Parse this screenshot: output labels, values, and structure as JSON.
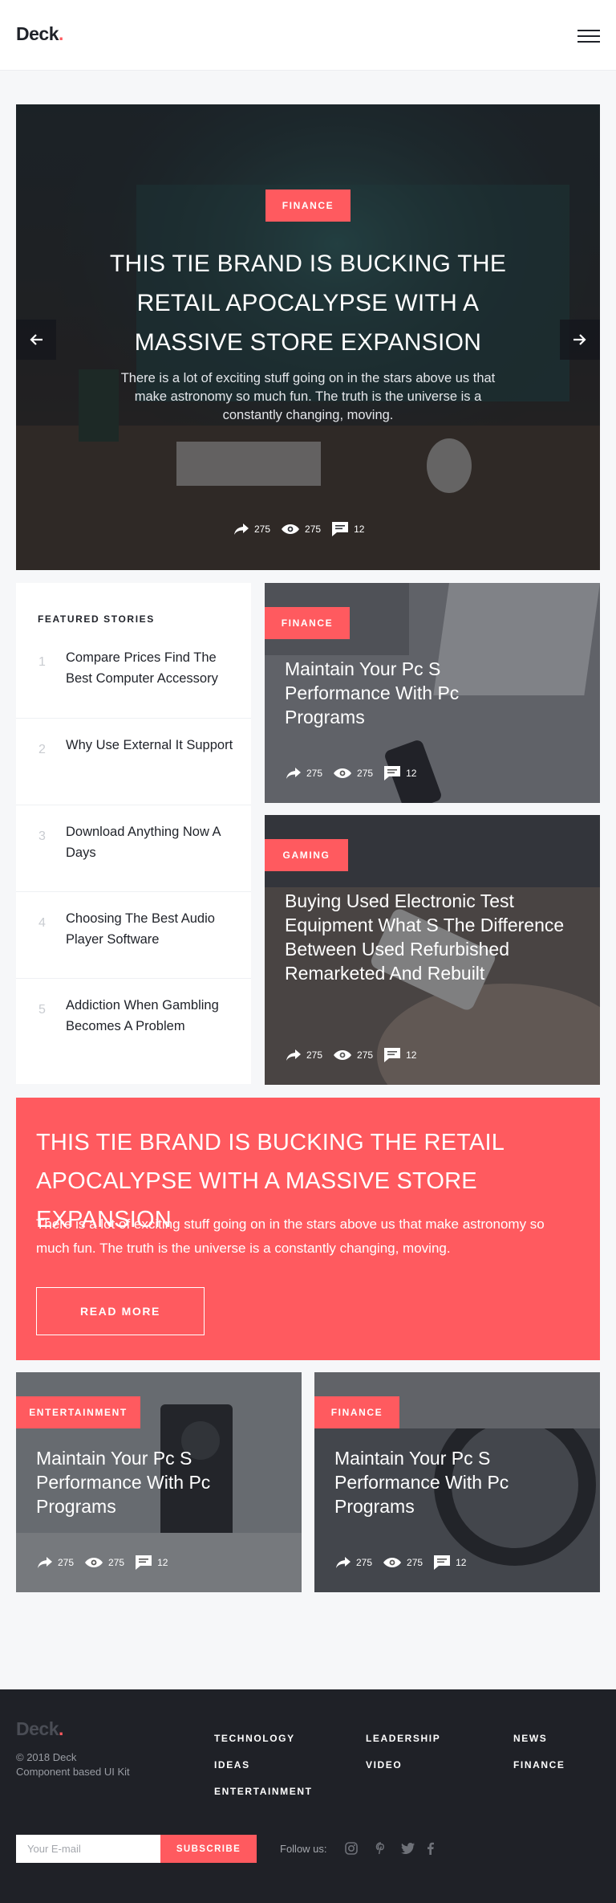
{
  "header": {
    "logo_text": "Deck",
    "logo_dot": "."
  },
  "hero": {
    "category": "Finance",
    "title": "This Tie Brand Is Bucking The Retail Apocalypse With A Massive Store Expansion",
    "excerpt": "There is a lot of exciting stuff going on in the stars above us that make astronomy so much fun. The truth is the universe is a constantly changing, moving.",
    "shares": "275",
    "views": "275",
    "comments": "12"
  },
  "featured": {
    "heading": "Featured Stories",
    "items": [
      {
        "num": "1",
        "title": "Compare Prices Find The Best Computer Accessory"
      },
      {
        "num": "2",
        "title": "Why Use External It Support"
      },
      {
        "num": "3",
        "title": "Download Anything Now A Days"
      },
      {
        "num": "4",
        "title": "Choosing The Best Audio Player Software"
      },
      {
        "num": "5",
        "title": "Addiction When Gambling Becomes A Problem"
      }
    ]
  },
  "cards": [
    {
      "category": "Finance",
      "title": "Maintain Your Pc S Performance With Pc Programs",
      "shares": "275",
      "views": "275",
      "comments": "12"
    },
    {
      "category": "Gaming",
      "title": "Buying Used Electronic Test Equipment What S The Difference Between Used Refurbished Remarketed And Rebuilt",
      "shares": "275",
      "views": "275",
      "comments": "12"
    },
    {
      "category": "Entertainment",
      "title": "Maintain Your Pc S Performance With Pc Programs",
      "shares": "275",
      "views": "275",
      "comments": "12"
    },
    {
      "category": "Finance",
      "title": "Maintain Your Pc S Performance With Pc Programs",
      "shares": "275",
      "views": "275",
      "comments": "12"
    }
  ],
  "cta": {
    "title": "This Tie Brand Is Bucking The Retail Apocalypse With A Massive Store Expansion",
    "text": "There is a lot of exciting stuff going on in the stars above us that make astronomy so much fun. The truth is the universe is a constantly changing, moving.",
    "button": "Read More"
  },
  "footer": {
    "logo_text": "Deck",
    "logo_dot": ".",
    "copyright": "© 2018 Deck",
    "tagline": "Component based UI Kit",
    "links": [
      "Technology",
      "Ideas",
      "Entertainment",
      "Leadership",
      "Video",
      "News",
      "Finance"
    ],
    "email_placeholder": "Your E-mail",
    "subscribe": "Subscribe",
    "follow": "Follow us:",
    "social_icons": [
      "instagram-icon",
      "pinterest-icon",
      "twitter-icon",
      "facebook-icon"
    ]
  },
  "colors": {
    "accent": "#ff5a5f",
    "footer_bg": "#1f2127",
    "page_bg": "#f6f7f9"
  }
}
